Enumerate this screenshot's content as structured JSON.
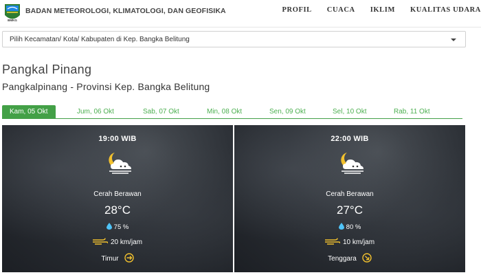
{
  "header": {
    "org_name": "BADAN METEOROLOGI, KLIMATOLOGI, DAN GEOFISIKA",
    "logo_text": "BMKG",
    "nav": [
      "PROFIL",
      "CUACA",
      "IKLIM",
      "KUALITAS UDARA"
    ]
  },
  "location_select": {
    "value": "Pilih Kecamatan/ Kota/ Kabupaten di Kep. Bangka Belitung",
    "icon": "caret-down-icon"
  },
  "city": "Pangkal Pinang",
  "subtitle": "Pangkalpinang - Provinsi Kep. Bangka Belitung",
  "tabs": [
    {
      "label": "Kam, 05 Okt",
      "active": true
    },
    {
      "label": "Jum, 06 Okt",
      "active": false
    },
    {
      "label": "Sab, 07 Okt",
      "active": false
    },
    {
      "label": "Min, 08 Okt",
      "active": false
    },
    {
      "label": "Sen, 09 Okt",
      "active": false
    },
    {
      "label": "Sel, 10 Okt",
      "active": false
    },
    {
      "label": "Rab, 11 Okt",
      "active": false
    }
  ],
  "colors": {
    "accent": "#43a047",
    "tab_text": "#4caf50",
    "card_bg": "#2c3036",
    "icon_yellow": "#f2c12e"
  },
  "forecasts": [
    {
      "time": "19:00 WIB",
      "icon": "moon-cloud-icon",
      "condition": "Cerah Berawan",
      "temperature": "28°C",
      "humidity": "75 %",
      "wind_speed": "20 km/jam",
      "wind_direction": "Timur"
    },
    {
      "time": "22:00 WIB",
      "icon": "moon-cloud-icon",
      "condition": "Cerah Berawan",
      "temperature": "27°C",
      "humidity": "80 %",
      "wind_speed": "10 km/jam",
      "wind_direction": "Tenggara"
    }
  ]
}
